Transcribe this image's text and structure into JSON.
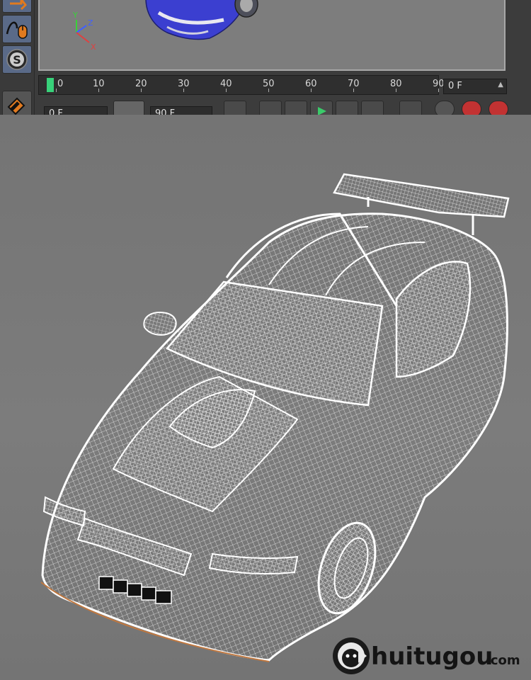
{
  "editor": {
    "axis_labels": {
      "y": "Y",
      "z": "Z",
      "x": "X"
    },
    "timeline": {
      "ticks": [
        "0",
        "10",
        "20",
        "30",
        "40",
        "50",
        "60",
        "70",
        "80",
        "90"
      ],
      "current_frame": "0 F"
    },
    "controls": {
      "start_field": "0 F",
      "end_field": "90 F"
    },
    "tool_icons": [
      "move-icon",
      "spline-mouse-icon",
      "snap-s-icon",
      "magnet-icon"
    ]
  },
  "watermark": {
    "brand": "Chuitugou",
    "brand_visible": "huitugou",
    "suffix": ".com"
  }
}
